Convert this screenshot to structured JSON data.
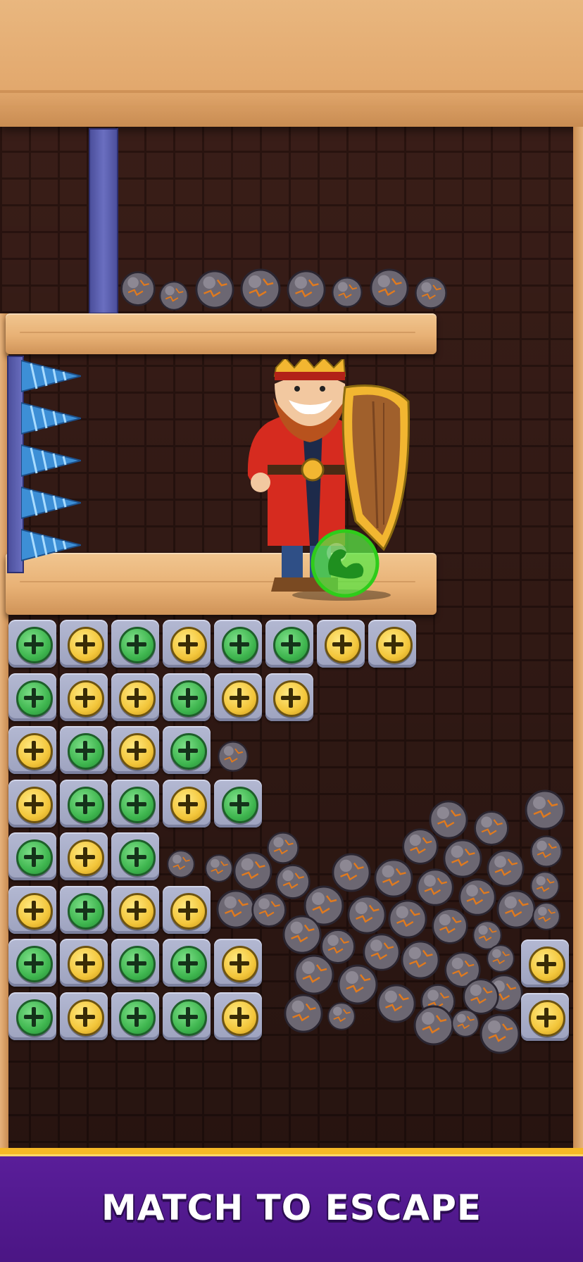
{
  "game": {
    "banner_title": "MATCH TO ESCAPE"
  },
  "colors": {
    "banner_bg": "#4a1583",
    "banner_border": "#f6b826",
    "screw_green": "#3fb64f",
    "screw_yellow": "#f3c63b",
    "wood": "#e8b175",
    "pin": "#5a5eb0"
  },
  "icons": {
    "character": "king-with-shield-icon",
    "boost": "muscle-arm-icon",
    "screw": "plus-screw-icon",
    "spike": "drill-spike-icon",
    "rock": "cracked-rock-icon"
  },
  "board": {
    "tile_rows": [
      [
        "green",
        "yellow",
        "green",
        "yellow",
        "green",
        "green",
        "yellow",
        "yellow"
      ],
      [
        "green",
        "yellow",
        "yellow",
        "green",
        "yellow",
        "yellow"
      ],
      [
        "yellow",
        "green",
        "yellow",
        "green"
      ],
      [
        "yellow",
        "green",
        "green",
        "yellow",
        "green"
      ],
      [
        "green",
        "yellow",
        "green"
      ],
      [
        "yellow",
        "green",
        "yellow",
        "yellow"
      ],
      [
        "green",
        "yellow",
        "green",
        "green",
        "yellow"
      ],
      [
        "green",
        "yellow",
        "green",
        "green",
        "yellow"
      ]
    ],
    "right_column": [
      "yellow",
      "yellow"
    ],
    "spike_count": 5
  }
}
